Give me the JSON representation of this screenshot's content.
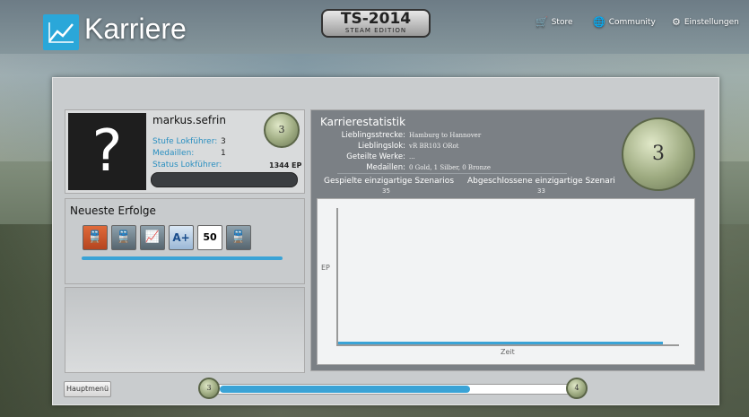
{
  "header": {
    "app_title": "Karriere",
    "ts_logo_title": "TS-2014",
    "ts_logo_subtitle": "STEAM EDITION",
    "nav": [
      {
        "label": "Store",
        "icon": "cart-icon"
      },
      {
        "label": "Community",
        "icon": "globe-icon"
      },
      {
        "label": "Einstellungen",
        "icon": "gear-icon"
      }
    ]
  },
  "profile": {
    "username": "markus.sefrin",
    "avatar_text": "?",
    "level": "3",
    "stats": [
      {
        "label": "Stufe Lokführer:",
        "value": "3"
      },
      {
        "label": "Medaillen:",
        "value": "1"
      },
      {
        "label": "Status Lokführer:",
        "value": ""
      }
    ],
    "ep": "1344 EP"
  },
  "achievements": {
    "title": "Neueste Erfolge",
    "icons": [
      "train-icon",
      "train-icon",
      "chart-icon",
      "a-plus-icon",
      "speed-limit-50-icon",
      "train-icon"
    ],
    "sign_text": "50"
  },
  "career": {
    "title": "Karrierestatistik",
    "level": "3",
    "rows": [
      {
        "label": "Lieblingsstrecke:",
        "value": "Hamburg to Hannover"
      },
      {
        "label": "Lieblingslok:",
        "value": "vR BR103 ORot"
      },
      {
        "label": "Geteilte Werke:",
        "value": "..."
      },
      {
        "label": "Medaillen:",
        "value": "0 Gold, 1 Silber, 0 Bronze"
      }
    ],
    "scenarios_played_label": "Gespielte einzigartige Szenarios",
    "scenarios_played_value": "35",
    "scenarios_completed_label": "Abgeschlossene einzigartige Szenari",
    "scenarios_completed_value": "33"
  },
  "chart": {
    "ylabel": "EP",
    "xlabel": "Zeit",
    "series_color": "#3aa3d6"
  },
  "footer": {
    "home_button": "Hauptmenü",
    "level_current": "3",
    "level_next": "4",
    "level_progress": 0.71
  },
  "colors": {
    "accent": "#2aa7d9",
    "panel": "#c9ccce",
    "stats_panel": "#7b8085"
  }
}
